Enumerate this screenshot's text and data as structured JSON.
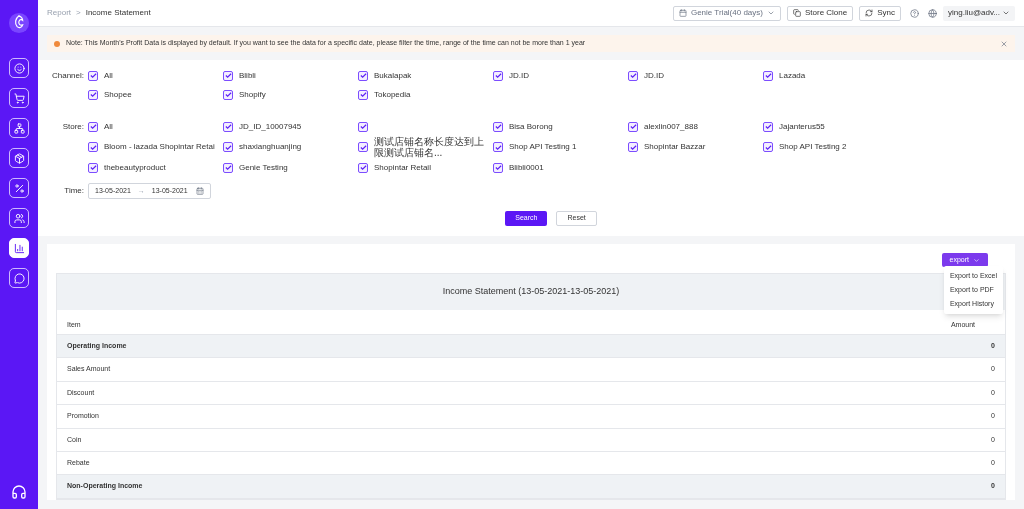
{
  "breadcrumb": [
    "Report",
    ">",
    "Income Statement"
  ],
  "header": {
    "plan": "Genie Trial(40 days)",
    "store_clone": "Store Clone",
    "sync": "Sync",
    "user": "ying.liu@adv..."
  },
  "sidebar": {
    "items": [
      {
        "kind": "face",
        "selected": false
      },
      {
        "kind": "cart",
        "selected": false
      },
      {
        "kind": "tree",
        "selected": false
      },
      {
        "kind": "box",
        "selected": false
      },
      {
        "kind": "percent",
        "selected": false
      },
      {
        "kind": "users",
        "selected": false
      },
      {
        "kind": "chart",
        "selected": true
      },
      {
        "kind": "chat",
        "selected": false
      }
    ]
  },
  "notice": "Note: This Month's Profit Data is displayed by default. If you want to see the data for a specific date, please filter the time, range of the time can not be more than 1 year",
  "filters": {
    "channel_label": "Channel:",
    "channels": [
      {
        "label": "All",
        "checked": true
      },
      {
        "label": "Blibli",
        "checked": true
      },
      {
        "label": "Bukalapak",
        "checked": true
      },
      {
        "label": "JD.ID",
        "checked": true
      },
      {
        "label": "JD.ID",
        "checked": true
      },
      {
        "label": "Lazada",
        "checked": true
      },
      {
        "label": "Shopee",
        "checked": true
      },
      {
        "label": "Shopify",
        "checked": true
      },
      {
        "label": "Tokopedia",
        "checked": true
      }
    ],
    "store_label": "Store:",
    "stores": [
      {
        "label": "All",
        "checked": true
      },
      {
        "label": "JD_ID_10007945",
        "checked": true
      },
      {
        "checked": true
      },
      {
        "label": "Bisa Borong",
        "checked": true
      },
      {
        "label": "alexlin007_888",
        "checked": true
      },
      {
        "label": "Jajanterus55",
        "checked": true
      },
      {
        "label": "Bloom - lazada Shopintar Retai",
        "checked": true
      },
      {
        "label": "shaxianghuanjing",
        "checked": true
      },
      {
        "label": "测试店铺名称长度达到上限测试店铺名...",
        "checked": true
      },
      {
        "label": "Shop API Testing 1",
        "checked": true
      },
      {
        "label": "Shopintar Bazzar",
        "checked": true
      },
      {
        "label": "Shop API Testing 2",
        "checked": true
      },
      {
        "label": "thebeautyproduct",
        "checked": true
      },
      {
        "label": "Genie Testing",
        "checked": true
      },
      {
        "label": "Shopintar Retail",
        "checked": true
      },
      {
        "label": "Blibli0001",
        "checked": true
      }
    ],
    "time_label": "Time:",
    "date_from": "13-05-2021",
    "date_arrow": "→",
    "date_to": "13-05-2021",
    "search": "Search",
    "reset": "Reset"
  },
  "export": {
    "button": "export",
    "menu": [
      "Export to Excel",
      "Export to PDF",
      "Export History"
    ]
  },
  "table": {
    "title": "Income Statement (13-05-2021-13-05-2021)",
    "columns": [
      "Item",
      "Amount"
    ],
    "rows": [
      {
        "item": "Operating Income",
        "amount": "0",
        "kind": "group"
      },
      {
        "item": "Sales Amount",
        "amount": "0",
        "kind": "line"
      },
      {
        "item": "Discount",
        "amount": "0",
        "kind": "line"
      },
      {
        "item": "Promotion",
        "amount": "0",
        "kind": "line"
      },
      {
        "item": "Coin",
        "amount": "0",
        "kind": "line"
      },
      {
        "item": "Rebate",
        "amount": "0",
        "kind": "line"
      },
      {
        "item": "Non-Operating Income",
        "amount": "0",
        "kind": "group"
      }
    ]
  }
}
